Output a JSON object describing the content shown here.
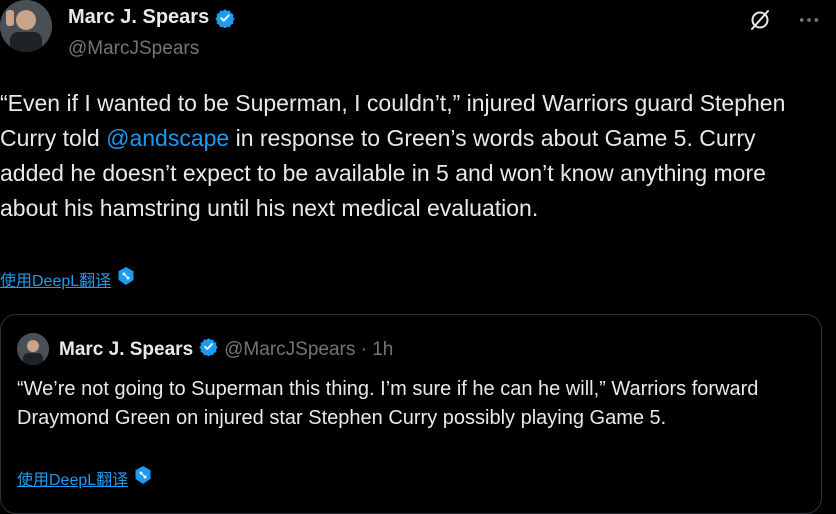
{
  "author": {
    "display_name": "Marc J. Spears",
    "handle": "@MarcJSpears"
  },
  "tweet": {
    "text_part1": "“Even if I wanted to be Superman, I couldn’t,” injured Warriors guard Stephen Curry told ",
    "mention": "@andscape",
    "text_part2": " in response to Green’s words about Game 5. Curry added he doesn’t expect to be available in 5 and won’t know anything more about his hamstring until his next medical evaluation.",
    "translate_label": "使用DeepL翻译"
  },
  "quoted_tweet": {
    "display_name": "Marc J. Spears",
    "meta": "@MarcJSpears · 1h",
    "text": "“We’re not going to Superman this thing. I’m sure if he can he will,” Warriors forward Draymond Green on injured star Stephen Curry possibly playing Game 5.",
    "translate_label": "使用DeepL翻译"
  },
  "icons": {
    "top_left": "grok-slash-icon",
    "top_right": "more-icon",
    "verified": "verified-badge-icon",
    "deepl": "deepl-icon"
  },
  "colors": {
    "background": "#000000",
    "text": "#e7e9ea",
    "secondary": "#71767b",
    "accent": "#1d9bf0"
  }
}
